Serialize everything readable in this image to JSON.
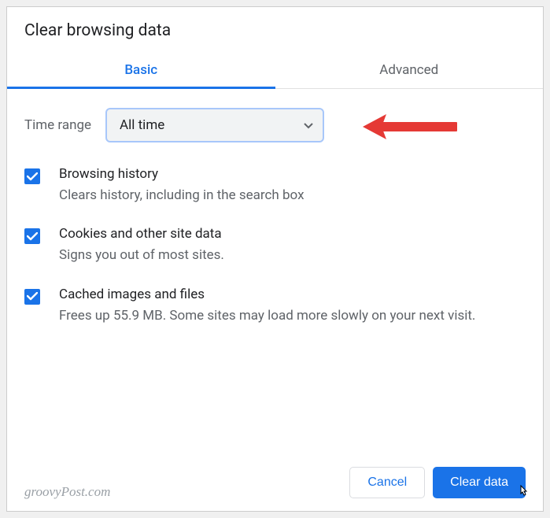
{
  "title": "Clear browsing data",
  "tabs": {
    "basic": "Basic",
    "advanced": "Advanced"
  },
  "time_range": {
    "label": "Time range",
    "value": "All time"
  },
  "options": [
    {
      "title": "Browsing history",
      "desc": "Clears history, including in the search box"
    },
    {
      "title": "Cookies and other site data",
      "desc": "Signs you out of most sites."
    },
    {
      "title": "Cached images and files",
      "desc": "Frees up 55.9 MB. Some sites may load more slowly on your next visit."
    }
  ],
  "buttons": {
    "cancel": "Cancel",
    "clear": "Clear data"
  },
  "watermark": "groovyPost.com"
}
